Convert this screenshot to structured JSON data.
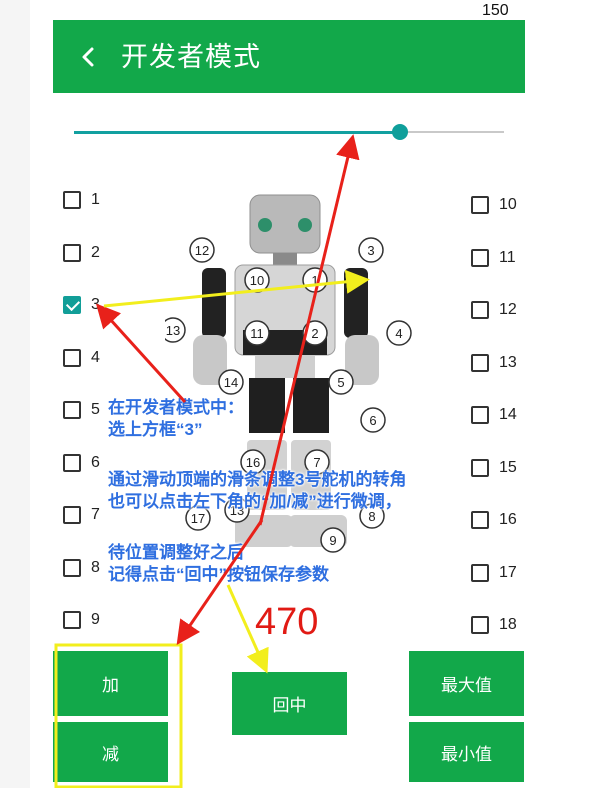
{
  "status_bar": {
    "time": "150"
  },
  "app_bar": {
    "title": "开发者模式"
  },
  "slider": {
    "value_fraction": 0.76
  },
  "checkboxes_left": [
    {
      "label": "1",
      "checked": false
    },
    {
      "label": "2",
      "checked": false
    },
    {
      "label": "3",
      "checked": true
    },
    {
      "label": "4",
      "checked": false
    },
    {
      "label": "5",
      "checked": false
    },
    {
      "label": "6",
      "checked": false
    },
    {
      "label": "7",
      "checked": false
    },
    {
      "label": "8",
      "checked": false
    },
    {
      "label": "9",
      "checked": false
    }
  ],
  "checkboxes_right": [
    {
      "label": "10",
      "checked": false
    },
    {
      "label": "11",
      "checked": false
    },
    {
      "label": "12",
      "checked": false
    },
    {
      "label": "13",
      "checked": false
    },
    {
      "label": "14",
      "checked": false
    },
    {
      "label": "15",
      "checked": false
    },
    {
      "label": "16",
      "checked": false
    },
    {
      "label": "17",
      "checked": false
    },
    {
      "label": "18",
      "checked": false
    }
  ],
  "servo_labels": [
    "12",
    "10",
    "1",
    "3",
    "13",
    "11",
    "2",
    "4",
    "14",
    "5",
    "6",
    "16",
    "7",
    "17",
    "13",
    "8",
    "9"
  ],
  "value_display": "470",
  "buttons": {
    "add": "加",
    "subtract": "减",
    "center": "回中",
    "max": "最大值",
    "min": "最小值"
  },
  "annotations": {
    "line1": "在开发者模式中：",
    "line2": "选上方框“3”",
    "line3": "通过滑动顶端的滑条调整3号舵机的转角",
    "line4": "也可以点击左下角的“加/减”进行微调，",
    "line5": "待位置调整好之后",
    "line6": "记得点击“回中”按钮保存参数"
  },
  "colors": {
    "primary_green": "#12a84a",
    "slider_teal": "#0f9f9b",
    "value_red": "#e11a14",
    "annotation_blue": "#2f6fe0",
    "arrow_red": "#e8211a",
    "arrow_yellow": "#f2ee1d"
  }
}
